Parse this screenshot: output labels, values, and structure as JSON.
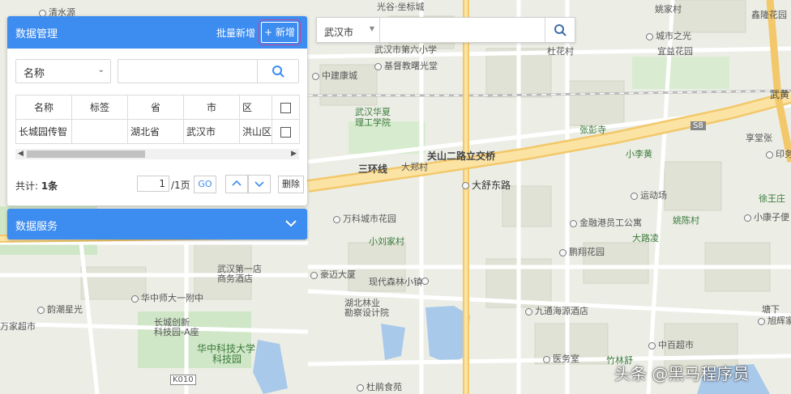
{
  "map": {
    "labels": {
      "qingshuiyuan": "清水源",
      "guanggu_zuobiao": "光谷·坐标城",
      "yaojiacun": "姚家村",
      "xinlongfu": "鑫隆花园",
      "wuhan_disixiaoxue": "武汉市第六小学",
      "jiduxiao": "基督教曙光堂",
      "duhuacun": "杜花村",
      "chengshizhiguang": "城市之光",
      "yiquanhuayuan": "宜益花园",
      "zhongjiankangcheng": "中建康城",
      "wuhanhuaxia": "武汉华夏",
      "ligongxueyuan": "理工学院",
      "zhangbiansi": "张彭寺",
      "xiangwuzhang": "享堂张",
      "yinlu": "印务",
      "xiaoliqiang": "小李黄",
      "yundongchang": "运动场",
      "xuwangzhuang": "徐王庄",
      "dashudonglu": "大舒东路",
      "wankecheng": "万科城市花园",
      "jinronggang": "金融港员工公寓",
      "yaochencun": "姚陈村",
      "xiaokanzi": "小康子便",
      "xiaoliujiacun": "小刘家村",
      "dalufeng": "大路凌",
      "pengyanghuayuan": "鹏翔花园",
      "wuhandongdian": "武汉第一店",
      "shangwujiudian": "商务酒店",
      "haoweidasha": "豪迈大厦",
      "xiandaisenlin": "现代森林小镇",
      "huazhongshida": "华中师大一附中",
      "runchengxingguang": "韵潮星光",
      "hubeilinye": "湖北林业",
      "kanchasheji": "勘察设计院",
      "jiutongyuan": "九通海源酒店",
      "wanjiachaoshi": "万家超市",
      "changchengchuangxin": "长城创新",
      "kejiyuan_a": "科技园-A座",
      "tangxia": "塘下",
      "xuwanjiayuan": "旭辉家园",
      "huazhongkeji": "华中科技大学",
      "huazhongkeji2": "科技园",
      "zhongbaichaoshi": "中百超市",
      "zhulinshu": "竹林舒",
      "yiwushi": "医务室",
      "dupengshiguan": "杜鹃食苑",
      "k010": "K010",
      "s8": "S8",
      "wuhuang": "武黄"
    },
    "roads": {
      "guanshan_overpass": "关山二路立交桥",
      "sanhuanxian": "三环线",
      "dazhengcun": "大郑村"
    }
  },
  "panel": {
    "title": "数据管理",
    "batch_add": "批量新增",
    "add_label": "+ 新增",
    "filter_field": "名称",
    "search_value": "",
    "table": {
      "headers": [
        "名称",
        "标签",
        "省",
        "市",
        "区"
      ],
      "rows": [
        [
          "长城园传智",
          "",
          "湖北省",
          "武汉市",
          "洪山区"
        ]
      ]
    },
    "total_label": "共计: ",
    "total_count": "1条",
    "current_page": "1",
    "pages_label": "/1页",
    "go_label": "GO",
    "delete_label": "删除"
  },
  "services": {
    "title": "数据服务"
  },
  "city_search": {
    "city": "武汉市",
    "query": ""
  },
  "watermark": "头条 @黑马程序员"
}
